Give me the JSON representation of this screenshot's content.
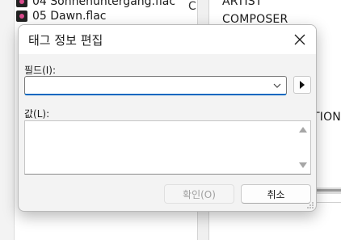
{
  "background": {
    "tracks": [
      {
        "label": "04 Sonnenuntergang.flac"
      },
      {
        "label": "05 Dawn.flac"
      }
    ],
    "column_fragment": "C",
    "fields": [
      "ARTIST",
      "COMPOSER",
      "TION"
    ]
  },
  "dialog": {
    "title": "태그 정보 편집",
    "field_label": "필드(I):",
    "field_value": "",
    "value_label": "값(L):",
    "value_text": "",
    "ok_label": "확인(O)",
    "cancel_label": "취소",
    "ok_enabled": false
  },
  "colors": {
    "accent": "#0067c0",
    "dialog_bg": "#f3f3f3",
    "titlebar_bg": "#ffffff",
    "disabled_text": "#a0a0a0"
  },
  "icons": {
    "close": "close-icon",
    "dropdown": "chevron-down-icon",
    "arrow": "triangle-right-icon",
    "scroll_up": "scroll-up-icon",
    "scroll_down": "scroll-down-icon",
    "track": "audio-file-icon"
  }
}
